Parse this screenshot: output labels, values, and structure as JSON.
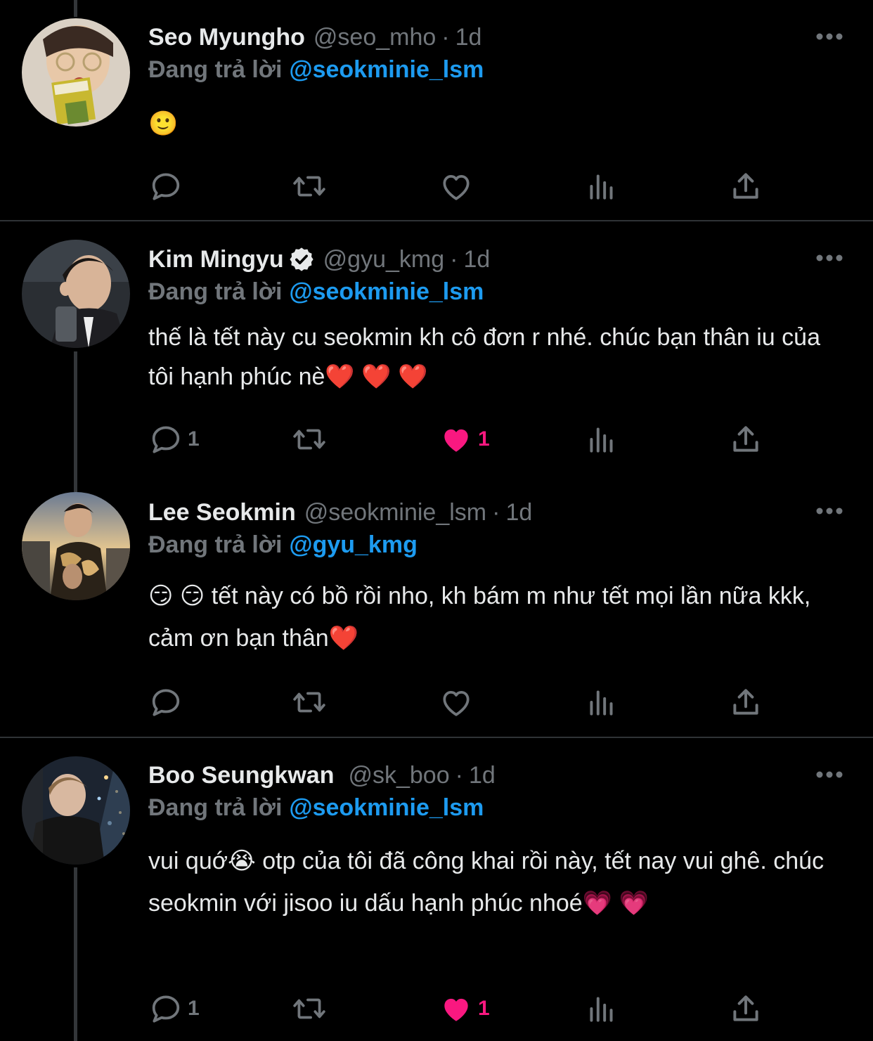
{
  "replying_label": "Đang trả lời",
  "tweets": [
    {
      "name": "Seo Myungho",
      "handle": "@seo_mho",
      "time": "1d",
      "verified": false,
      "reply_to": "@seokminie_lsm",
      "text": "🙂",
      "reply_count": "",
      "like_count": "",
      "liked": false
    },
    {
      "name": "Kim Mingyu",
      "handle": "@gyu_kmg",
      "time": "1d",
      "verified": true,
      "reply_to": "@seokminie_lsm",
      "text": "thế là tết này cu seokmin kh cô đơn r nhé. chúc bạn thân iu của tôi hạnh phúc nè❤️ ❤️ ❤️",
      "reply_count": "1",
      "like_count": "1",
      "liked": true
    },
    {
      "name": "Lee Seokmin",
      "handle": "@seokminie_lsm",
      "time": "1d",
      "verified": false,
      "reply_to": "@gyu_kmg",
      "text": "😏 😏 tết này có bồ rồi nho, kh bám m như tết mọi lần nữa kkk, cảm ơn bạn thân❤️",
      "reply_count": "",
      "like_count": "",
      "liked": false
    },
    {
      "name": "Boo Seungkwan",
      "handle": "@sk_boo",
      "time": "1d",
      "verified": false,
      "reply_to": "@seokminie_lsm",
      "text": "vui quớ😭 otp của tôi đã công khai rồi này, tết nay vui ghê. chúc seokmin với jisoo iu dấu hạnh phúc nhoé💗 💗",
      "reply_count": "1",
      "like_count": "1",
      "liked": true
    }
  ],
  "colors": {
    "background": "#000000",
    "text": "#e7e9ea",
    "secondary": "#71767b",
    "mention": "#1d9bf0",
    "like": "#f91880"
  }
}
